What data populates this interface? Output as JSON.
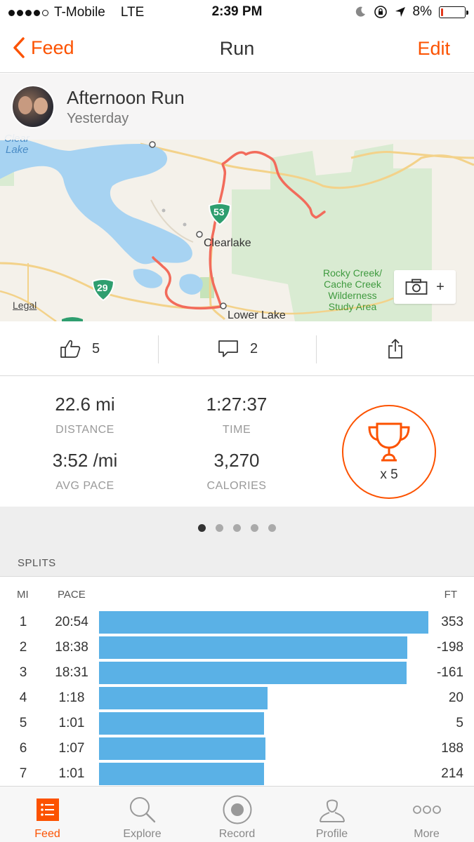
{
  "status_bar": {
    "carrier": "T-Mobile",
    "network": "LTE",
    "time": "2:39 PM",
    "battery": "8%",
    "battery_fraction": 0.08,
    "icons": [
      "signal-dots",
      "moon-icon",
      "rotation-lock-icon",
      "location-arrow-icon",
      "battery-icon"
    ]
  },
  "nav": {
    "back_label": "Feed",
    "title": "Run",
    "edit_label": "Edit"
  },
  "activity": {
    "title": "Afternoon Run",
    "date": "Yesterday"
  },
  "map": {
    "labels": {
      "clear_lake_1": "Clear",
      "clear_lake_2": "Lake",
      "town": "Clearlake",
      "lower_lake": "Lower Lake",
      "highway_53": "53",
      "highway_29": "29",
      "area_1": "Rocky Creek/",
      "area_2": "Cache Creek",
      "area_3": "Wilderness",
      "area_4": "Study Area",
      "legal": "Legal"
    },
    "camera_plus": "+",
    "colors": {
      "route": "#f26b5b",
      "water": "#a7d3f2",
      "park": "#d6ebcf",
      "road": "#f3d28a"
    }
  },
  "social": {
    "kudos_count": "5",
    "comments_count": "2"
  },
  "stats": {
    "distance_value": "22.6 mi",
    "distance_label": "DISTANCE",
    "time_value": "1:27:37",
    "time_label": "TIME",
    "pace_value": "3:52 /mi",
    "pace_label": "AVG PACE",
    "calories_value": "3,270",
    "calories_label": "CALORIES",
    "achievements": "x 5"
  },
  "pager": {
    "pages": 5,
    "active": 0
  },
  "splits": {
    "header": "SPLITS",
    "col_mi": "MI",
    "col_pace": "PACE",
    "col_ft": "FT",
    "rows": [
      {
        "mi": "1",
        "pace": "20:54",
        "ft": "353",
        "bar_fraction": 1.0
      },
      {
        "mi": "2",
        "pace": "18:38",
        "ft": "-198",
        "bar_fraction": 0.936
      },
      {
        "mi": "3",
        "pace": "18:31",
        "ft": "-161",
        "bar_fraction": 0.933
      },
      {
        "mi": "4",
        "pace": "1:18",
        "ft": "20",
        "bar_fraction": 0.511
      },
      {
        "mi": "5",
        "pace": "1:01",
        "ft": "5",
        "bar_fraction": 0.502
      },
      {
        "mi": "6",
        "pace": "1:07",
        "ft": "188",
        "bar_fraction": 0.505
      },
      {
        "mi": "7",
        "pace": "1:01",
        "ft": "214",
        "bar_fraction": 0.502
      }
    ]
  },
  "tabs": [
    {
      "label": "Feed",
      "icon": "feed-icon",
      "active": true
    },
    {
      "label": "Explore",
      "icon": "search-icon",
      "active": false
    },
    {
      "label": "Record",
      "icon": "record-icon",
      "active": false
    },
    {
      "label": "Profile",
      "icon": "profile-icon",
      "active": false
    },
    {
      "label": "More",
      "icon": "more-icon",
      "active": false
    }
  ],
  "colors": {
    "accent": "#fc5200",
    "split_bar": "#5ab1e6"
  }
}
